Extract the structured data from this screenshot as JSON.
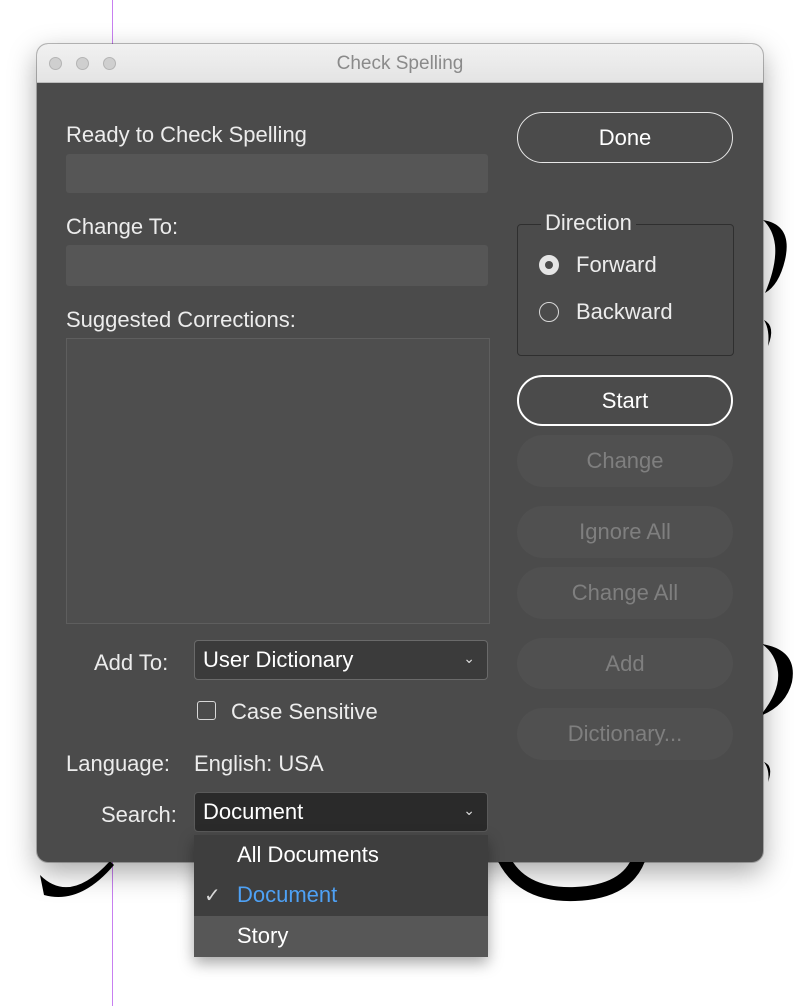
{
  "window": {
    "title": "Check Spelling"
  },
  "labels": {
    "ready": "Ready to Check Spelling",
    "change_to": "Change To:",
    "suggested": "Suggested Corrections:",
    "add_to": "Add To:",
    "case_sensitive": "Case Sensitive",
    "language_label": "Language:",
    "language_value": "English: USA",
    "search": "Search:"
  },
  "fields": {
    "ready_value": "",
    "change_to_value": ""
  },
  "add_to_select": {
    "value": "User Dictionary"
  },
  "search_select": {
    "value": "Document"
  },
  "case_sensitive_checked": false,
  "direction": {
    "title": "Direction",
    "options": [
      {
        "label": "Forward",
        "selected": true
      },
      {
        "label": "Backward",
        "selected": false
      }
    ]
  },
  "buttons": {
    "done": "Done",
    "start": "Start",
    "change": "Change",
    "ignore_all": "Ignore All",
    "change_all": "Change All",
    "add": "Add",
    "dictionary": "Dictionary..."
  },
  "search_menu": {
    "items": [
      {
        "label": "All Documents",
        "checked": false
      },
      {
        "label": "Document",
        "checked": true
      },
      {
        "label": "Story",
        "checked": false
      }
    ]
  },
  "colors": {
    "accent": "#4ea1f5",
    "dialog_bg": "#4b4b4b"
  }
}
